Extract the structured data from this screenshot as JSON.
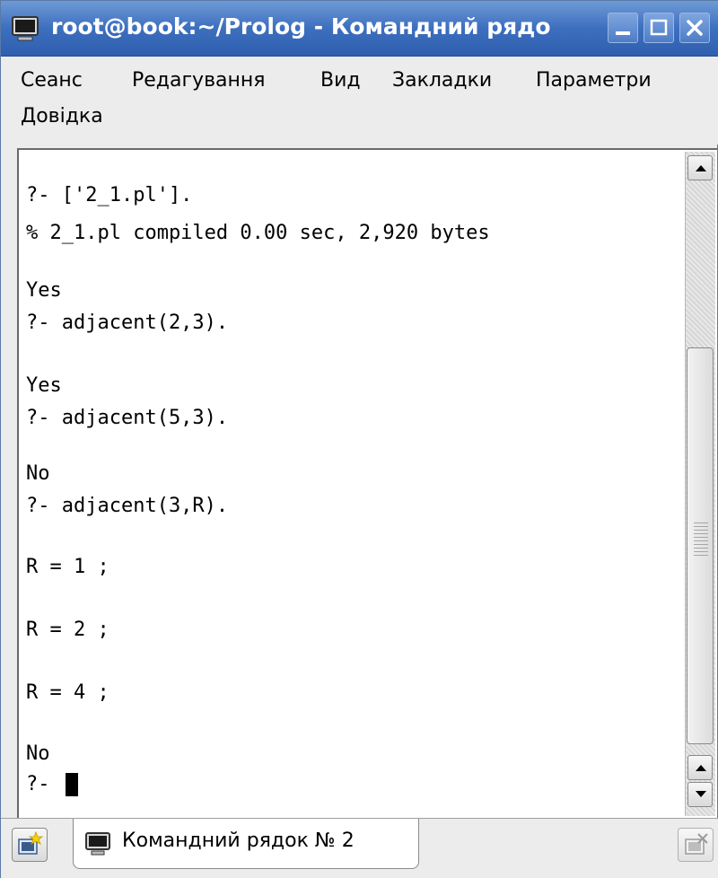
{
  "window": {
    "title": "root@book:~/Prolog - Командний рядо"
  },
  "menu": {
    "session": "Сеанс",
    "edit": "Редагування",
    "view": "Вид",
    "bookmarks": "Закладки",
    "settings": "Параметри",
    "help": "Довідка"
  },
  "terminal": {
    "lines": [
      "?- ['2_1.pl'].",
      "% 2_1.pl compiled 0.00 sec, 2,920 bytes",
      "",
      "Yes",
      "?- adjacent(2,3).",
      "",
      "Yes",
      "?- adjacent(5,3).",
      "",
      "No",
      "?- adjacent(3,R).",
      "",
      "R = 1 ;",
      "",
      "R = 2 ;",
      "",
      "R = 4 ;",
      "",
      "No",
      "?- "
    ]
  },
  "tabs": [
    {
      "label": "Командний рядок № 2"
    }
  ],
  "icons": {
    "app": "terminal-icon",
    "minimize": "minimize-icon",
    "maximize": "maximize-icon",
    "close": "close-icon",
    "new_tab": "new-tab-icon",
    "close_tab": "close-tab-icon",
    "scroll_up": "arrow-up-icon",
    "scroll_down": "arrow-down-icon"
  },
  "colors": {
    "titlebar": "#3d6fbf",
    "terminal_bg": "#ffffff",
    "terminal_fg": "#000000"
  }
}
